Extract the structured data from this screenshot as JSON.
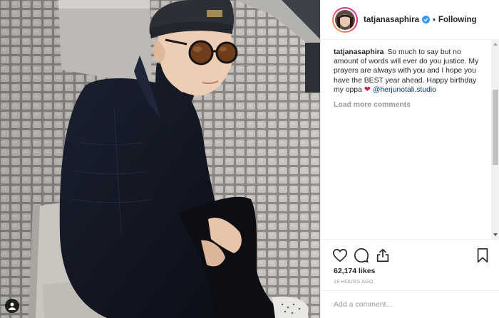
{
  "post": {
    "username": "tatjanasaphira",
    "following_label": "Following",
    "separator": "•"
  },
  "caption": {
    "username": "tatjanasaphira",
    "text": "So much to say but no amount of words will ever do you justice. My prayers are always with you and I hope you have the BEST year ahead. Happy birthday my oppa",
    "emoji": "❤",
    "mention": "@herjunotali.studio"
  },
  "load_more_label": "Load more comments",
  "likes_label": "62,174 likes",
  "timestamp": "18 HOURS AGO",
  "comment_placeholder": "Add a comment...",
  "colors": {
    "verified": "#3897f0",
    "link": "#003569",
    "heart": "#d81b3a",
    "muted": "#999999"
  },
  "icons": [
    "heart-icon",
    "comment-icon",
    "share-icon",
    "bookmark-icon",
    "verified-badge-icon",
    "user-tag-icon"
  ]
}
